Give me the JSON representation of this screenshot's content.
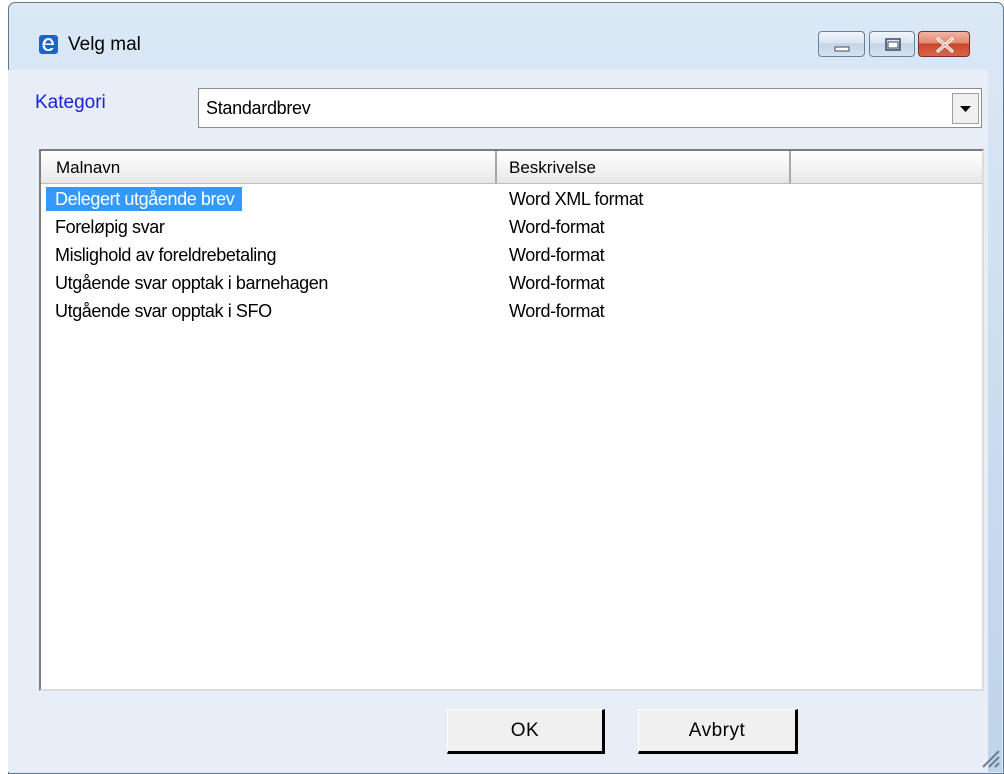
{
  "window": {
    "title": "Velg mal",
    "icon": "e-app-icon"
  },
  "category": {
    "label": "Kategori",
    "value": "Standardbrev"
  },
  "list": {
    "columns": [
      "Malnavn",
      "Beskrivelse",
      ""
    ],
    "rows": [
      {
        "name": "Delegert utgående brev",
        "description": "Word XML format",
        "selected": true
      },
      {
        "name": "Foreløpig svar",
        "description": "Word-format",
        "selected": false
      },
      {
        "name": "Mislighold av foreldrebetaling",
        "description": "Word-format",
        "selected": false
      },
      {
        "name": "Utgående svar opptak i barnehagen",
        "description": "Word-format",
        "selected": false
      },
      {
        "name": "Utgående svar opptak i SFO",
        "description": "Word-format",
        "selected": false
      }
    ]
  },
  "buttons": {
    "ok": "OK",
    "cancel": "Avbryt"
  },
  "colors": {
    "category_label": "#1c22d6",
    "selection": "#3399ff"
  }
}
